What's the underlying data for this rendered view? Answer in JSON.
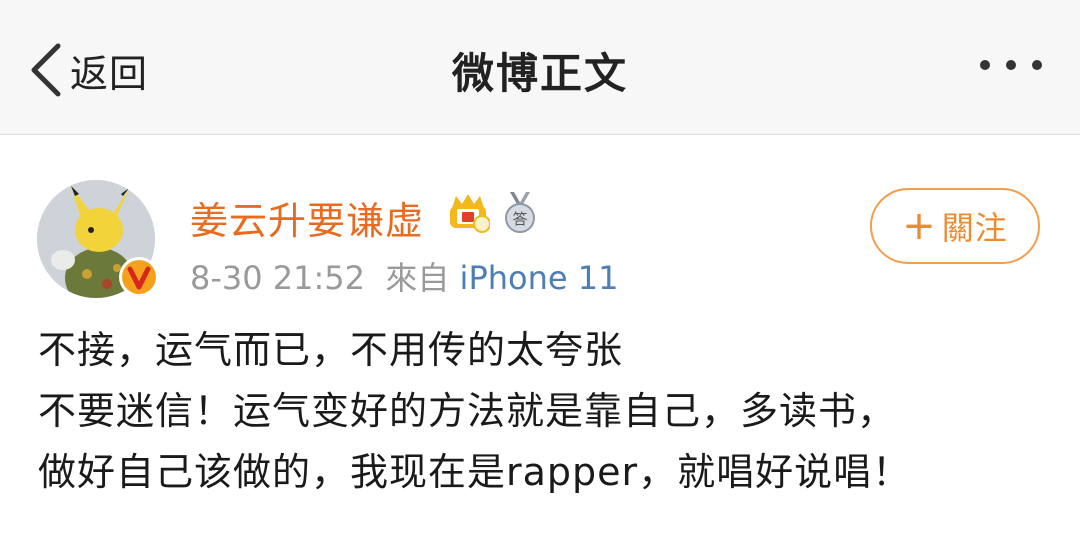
{
  "navbar": {
    "back_label": "返回",
    "title": "微博正文",
    "more_icon": "more-dots-icon"
  },
  "post": {
    "username": "姜云升要谦虚",
    "time": "8-30 21:52",
    "source_prefix": "來自",
    "device": "iPhone 11",
    "follow_plus": "+",
    "follow_label": "關注",
    "lines": [
      "不接，运气而已，不用传的太夸张",
      "不要迷信！运气变好的方法就是靠自己，多读书，",
      "做好自己该做的，我现在是rapper，就唱好说唱！"
    ]
  },
  "colors": {
    "username": "#e86b1f",
    "follow": "#ee8a2f",
    "device_link": "#4f7db5",
    "meta": "#9a9a9a"
  },
  "badges": [
    "crown-member-icon",
    "medal-answer-icon",
    "verified-v-icon"
  ]
}
